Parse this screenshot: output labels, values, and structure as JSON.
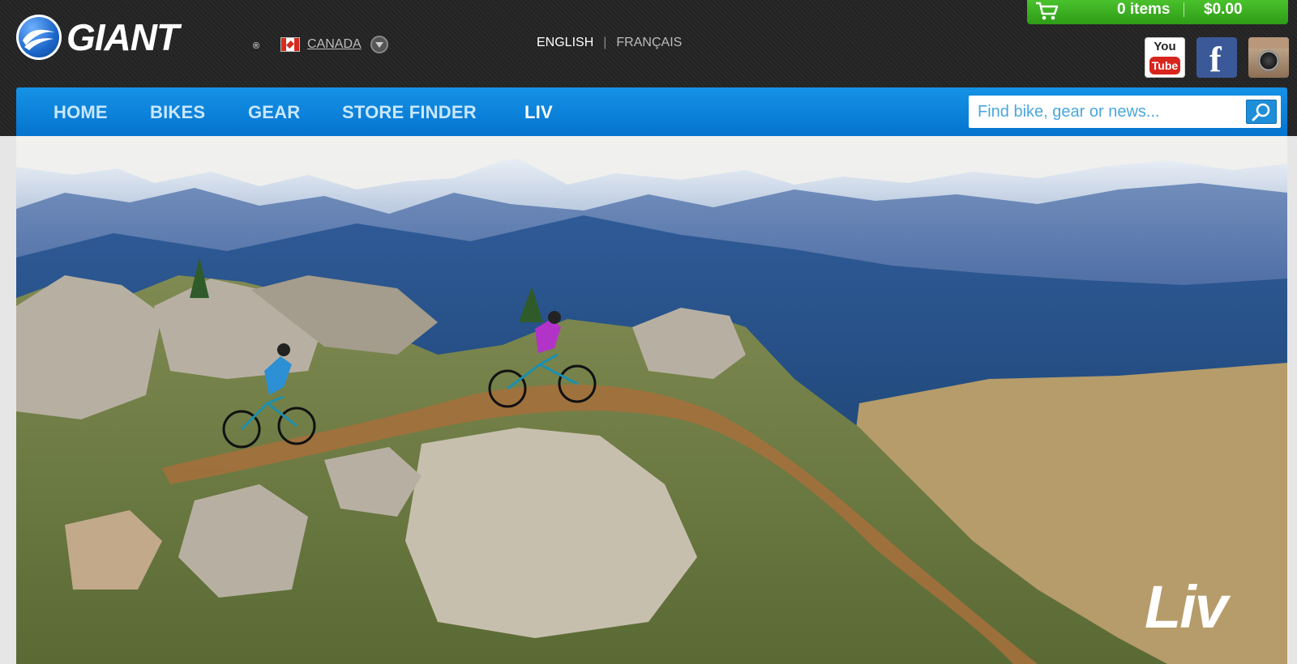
{
  "header": {
    "brand": "GIANT",
    "brand_mark": "®",
    "region": {
      "label": "CANADA",
      "flag_icon": "canada-flag-icon"
    },
    "languages": {
      "current": "ENGLISH",
      "other": "FRANÇAIS"
    },
    "cart": {
      "items_label": "0 items",
      "total": "$0.00"
    },
    "social": {
      "youtube_top": "You",
      "youtube_bottom": "Tube",
      "facebook": "f"
    }
  },
  "nav": {
    "items": [
      {
        "label": "HOME"
      },
      {
        "label": "BIKES"
      },
      {
        "label": "GEAR"
      },
      {
        "label": "STORE FINDER"
      },
      {
        "label": "LIV"
      }
    ]
  },
  "search": {
    "placeholder": "Find bike, gear or news..."
  },
  "hero": {
    "brand_logo": "Liv"
  },
  "colors": {
    "nav_blue": "#0a84d6",
    "cart_green": "#3fb524",
    "topbar_dark": "#252525"
  }
}
